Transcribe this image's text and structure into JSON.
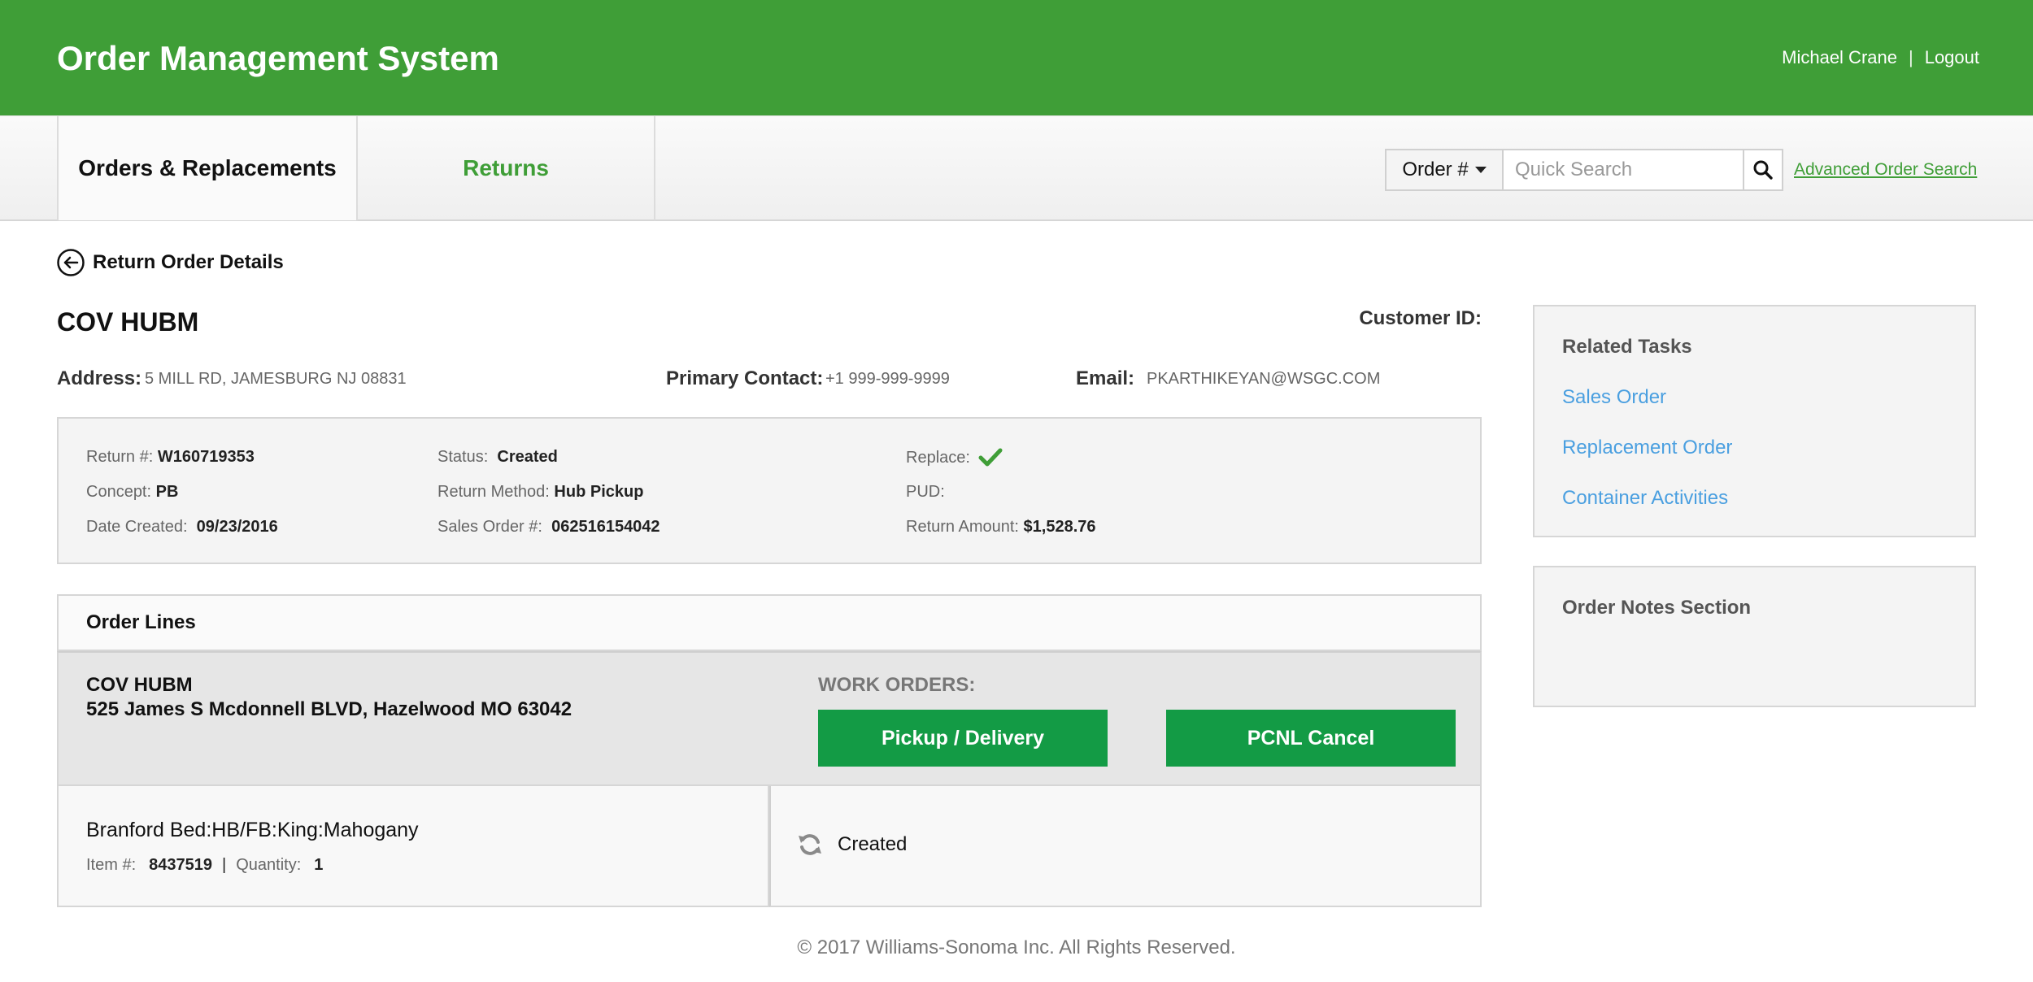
{
  "header": {
    "app_title": "Order Management System",
    "user_name": "Michael Crane",
    "separator": "|",
    "logout_label": "Logout"
  },
  "nav": {
    "tab_orders": "Orders & Replacements",
    "tab_returns": "Returns",
    "search_type": "Order #",
    "search_placeholder": "Quick Search",
    "advanced_search": "Advanced Order Search"
  },
  "page": {
    "back_title": "Return Order Details"
  },
  "customer": {
    "name": "COV HUBM",
    "customer_id_label": "Customer ID:",
    "address_label": "Address:",
    "address_value": "5 MILL RD, JAMESBURG NJ 08831",
    "contact_label": "Primary Contact:",
    "contact_value": "+1 999-999-9999",
    "email_label": "Email:",
    "email_value": "PKARTHIKEYAN@WSGC.COM"
  },
  "summary": {
    "return_label": "Return #:",
    "return_value": "W160719353",
    "concept_label": "Concept:",
    "concept_value": "PB",
    "date_label": "Date Created:",
    "date_value": "09/23/2016",
    "status_label": "Status:",
    "status_value": "Created",
    "method_label": "Return Method:",
    "method_value": "Hub Pickup",
    "sales_label": "Sales Order #:",
    "sales_value": "062516154042",
    "replace_label": "Replace:",
    "pud_label": "PUD:",
    "amount_label": "Return Amount:",
    "amount_value": "$1,528.76"
  },
  "order_lines": {
    "title": "Order Lines",
    "ship_name": "COV HUBM",
    "ship_address": "525 James S Mcdonnell BLVD, Hazelwood MO 63042",
    "work_orders_label": "WORK ORDERS:",
    "btn_pickup": "Pickup / Delivery",
    "btn_pcnl": "PCNL Cancel",
    "item_name": "Branford Bed:HB/FB:King:Mahogany",
    "item_label": "Item #:",
    "item_value": "8437519",
    "qty_label": "Quantity:",
    "qty_value": "1",
    "item_status": "Created"
  },
  "sidebar": {
    "tasks_title": "Related Tasks",
    "tasks": [
      "Sales Order",
      "Replacement Order",
      "Container Activities"
    ],
    "notes_title": "Order Notes Section"
  },
  "footer": {
    "copyright": "© 2017 Williams-Sonoma Inc. All Rights Reserved."
  },
  "colors": {
    "brand_green": "#3f9e37",
    "button_green": "#139b45",
    "link_blue": "#4a9fe0"
  }
}
